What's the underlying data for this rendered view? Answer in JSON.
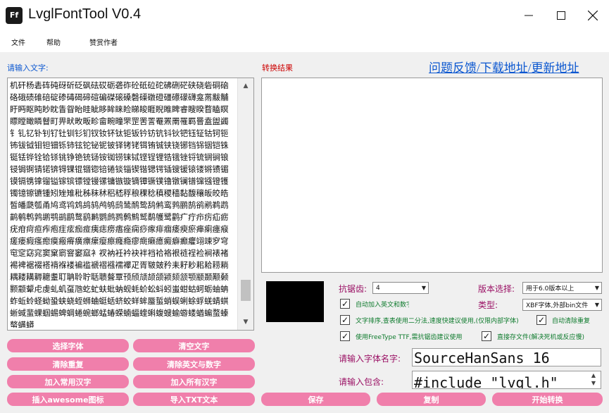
{
  "window": {
    "icon_text": "Ff",
    "title": "LvglFontTool V0.4"
  },
  "menu": [
    "文件",
    "帮助",
    "赞赏作者"
  ],
  "input_label": "请输入文字:",
  "result_label": "转换结果",
  "link": "问题反馈/下载地址/更新地址",
  "input_text": "机矸杨砉砗砘砑斫砭砜砝砹砺砻砟砼砥砬砣砩硎硭硖硗砦硐硇硌硪碛碓碚碇碜碡碣碲碹碥磔磙磉磬磲礅磴礓礤礞礴龛黹黻黼盱眄眍盹眇眈眚眢眙眭眦眵眸睐睑睇睃睚睨睢睥睿瞍睽瞀瞌瞑瞟瞠瞰瞵瞽町畀畎畋畈畛畲畹疃罘罡罟詈罨罴罱罹羁罾盍盥蠲钅钆钇钋钊钌钍钏钐钔钗钕钚钛钜钣钤钫钪钭钬钯钰钲钴钶钷钸钹钺钼钽钿铄铈铉铊铋铌铍铎铐铑铒铕铖铗铙铘铛铞铟铠铢铤铥铧铨铪铩铫铮铯铳铴铵铷铹铼铽铿锃锂锆锇锉锊锍锎锏锒锓锔锕锖锘锛锝锞锟锢锪锫锩锬锱锲锴锶锷锸锼锾锿镂锵镄镅镆镉镌镎镏镒镓镔镖镗镘镙镛镞镟镝镡镢镤镥镦镧镨镩镪镫镬镯镱镲镳锺矧矬雉秕秭秣秫稆嵇稃稂稞稔稹稷穑黏馥穰皈皎皓皙皤瓞瓠甬鸠鸢鸨鸩鸪鸫鸬鸲鸱鸶鸸鸷鸹鸺鸾鹁鹂鹄鹆鹇鹈鹉鹋鹌鹎鹑鹕鹗鹚鹛鹜鹞鹣鹦鹧鹨鹩鹪鹫鹬鹱鹭鹳疒疔疖疠疝疬疣疳疴疸痄疱疰痃痂痖痍痣痨痦痤痫痧瘃痱痼痿瘐瘀瘅瘌瘗瘊瘥瘘瘕瘙瘛瘼瘢瘠癀瘭瘰瘿瘵癃瘾瘳癍癞癔癜癖癫癯翊竦穸穹窀窆窈窕窦窠窬窨窭窳衤衩衲衽衿袂袢裆袷袼裉裢裎裣裥裱褚裼裨裾裰褡褙褓褛褊褴褫褶襁襦襻疋胥皲皴矜耒耔耖耜耠耢耥耦耧耩耨耱耋耵聃聆聍聒聩聱覃顸颀颃颉颌颍颏颔颚颛颞颟颡颢颥颦虍虔虬虮虿虺虼虻蚨蚍蚋蚬蚝蚧蚣蚪蚓蚩蚶蛄蚵蛎蚰蚺蚱蚯蛉蛏蚴蛩蛱蛲蛭蛳蛐蜓蛞蛴蛟蛘蛑蜃蜇蛸蜈蜊蜍蜉蜣蜻蜞蜥蜮蜚蜾蝈蜴蜱蜩蜷蜿螂蜢蝽蝾蝻蝠蝰蝌蝮螋蝓蝣蝼蝤蝙蝥螓螯螨蟒",
  "buttons_left": [
    "选择字体",
    "清空文字",
    "清除重复",
    "清除英文与数字",
    "加入常用汉字",
    "加入所有汉字",
    "插入awesome图标",
    "导入TXT文本"
  ],
  "buttons_right": [
    "保存",
    "复制",
    "开始转换"
  ],
  "antialias": {
    "label": "抗锯齿:",
    "value": "4"
  },
  "version": {
    "label": "版本选择:",
    "value": "用于6.0版本以上"
  },
  "type": {
    "label": "类型:",
    "value": "XBF字体,外部bin文件"
  },
  "checkboxes": [
    {
      "label": "自动加入英文和数字",
      "checked": true
    },
    {
      "label": "文字排序,查表使用二分法,速度快建议使用,(仅限内部字体)",
      "checked": true
    },
    {
      "label": "自动清除重复",
      "checked": true
    },
    {
      "label": "使用FreeType TTF,需抗锯齿建议使用",
      "checked": true
    },
    {
      "label": "直接存文件(解决死机或反应慢)",
      "checked": true
    }
  ],
  "font_name": {
    "label": "请输入字体名字:",
    "value": "SourceHanSans_16"
  },
  "include": {
    "label": "请输入包含:",
    "value": "#include \"lvgl.h\""
  }
}
